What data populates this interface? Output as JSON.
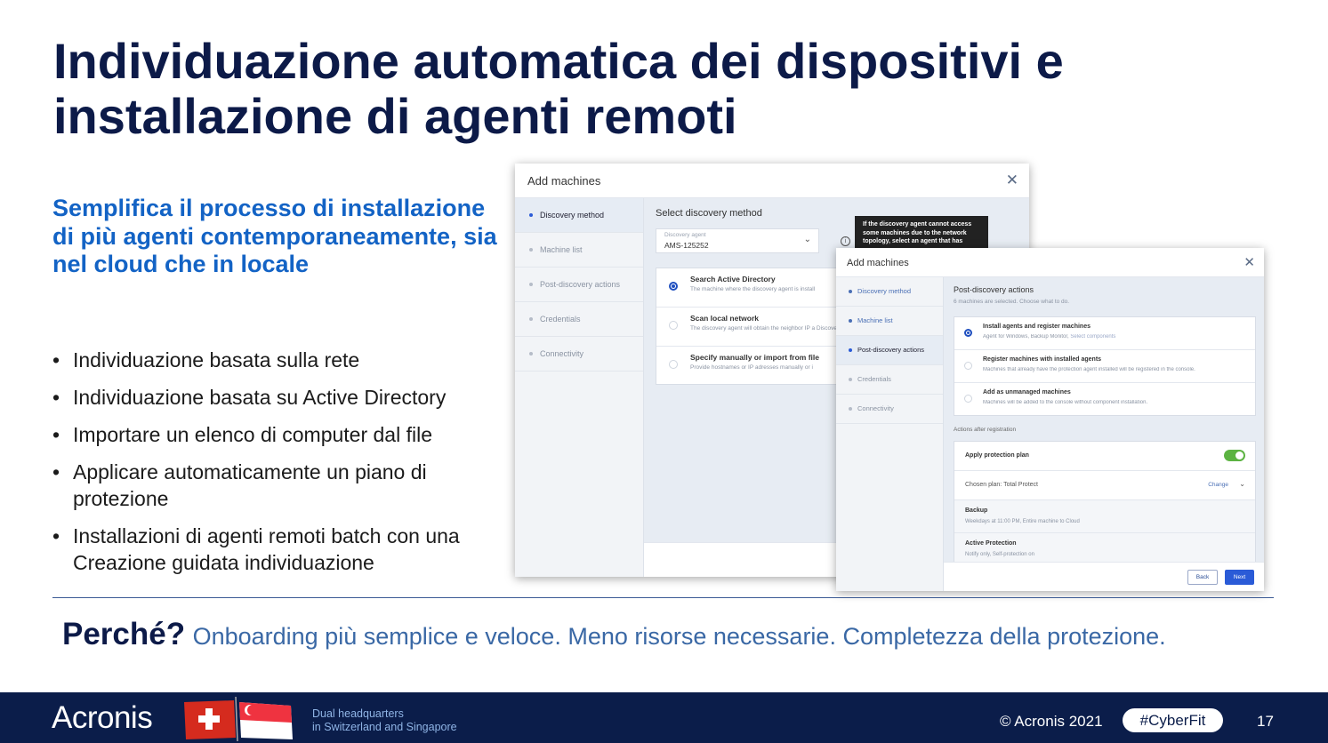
{
  "slide": {
    "title": "Individuazione automatica dei dispositivi e installazione di agenti remoti",
    "subheading": "Semplifica il processo di installazione di più agenti contemporaneamente, sia nel cloud che in locale",
    "bullets": [
      "Individuazione basata sulla rete",
      "Individuazione basata su Active Directory",
      "Importare un elenco di computer dal file",
      "Applicare automaticamente un piano di protezione",
      "Installazioni di agenti remoti batch con una Creazione guidata individuazione"
    ],
    "why_label": "Perché?",
    "why_text": "Onboarding più semplice e veloce. Meno risorse necessarie. Completezza della protezione."
  },
  "footer": {
    "logo": "Acronis",
    "hq_line1": "Dual headquarters",
    "hq_line2": "in Switzerland and Singapore",
    "copyright": "© Acronis 2021",
    "hashtag": "#CyberFit",
    "page_number": "17"
  },
  "dialog1": {
    "title": "Add machines",
    "close_icon": "close-icon",
    "sidebar": [
      "Discovery method",
      "Machine list",
      "Post-discovery actions",
      "Credentials",
      "Connectivity"
    ],
    "section_title": "Select discovery method",
    "agent_label": "Discovery agent",
    "agent_value": "AMS-125252",
    "tooltip": "If the discovery agent cannot access some machines due to the network topology, select an agent that has",
    "options": [
      {
        "title": "Search Active Directory",
        "desc": "The machine where the discovery agent is install",
        "selected": true
      },
      {
        "title": "Scan local network",
        "desc": "The discovery agent will obtain the neighbor IP a Discovery (WSD), and Address Resolution Protoc",
        "selected": false
      },
      {
        "title": "Specify manually or import from file",
        "desc": "Provide hostnames or IP adresses manually or i",
        "selected": false
      }
    ]
  },
  "dialog2": {
    "title": "Add machines",
    "close_icon": "close-icon",
    "sidebar": [
      "Discovery method",
      "Machine list",
      "Post-discovery actions",
      "Credentials",
      "Connectivity"
    ],
    "section_title": "Post-discovery actions",
    "section_sub": "6 machines are selected. Choose what to do.",
    "options": [
      {
        "title": "Install agents and register machines",
        "desc": "Agent for Windows, Backup Monitor,",
        "link": "Select components",
        "selected": true
      },
      {
        "title": "Register machines with installed agents",
        "desc": "Machines that already have the protection agent installed will be registered in the console.",
        "link": "",
        "selected": false
      },
      {
        "title": "Add as unmanaged machines",
        "desc": "Machines will be added to the console without component installation.",
        "link": "",
        "selected": false
      }
    ],
    "after_label": "Actions after registration",
    "apply_plan": "Apply protection plan",
    "apply_plan_on": true,
    "chosen_plan": "Chosen plan: Total Protect",
    "change": "Change",
    "backup_title": "Backup",
    "backup_desc": "Weekdays at 11:00 PM, Entire machine to Cloud",
    "ap_title": "Active Protection",
    "ap_desc": "Notify only, Self-protection on",
    "back": "Back",
    "next": "Next"
  }
}
